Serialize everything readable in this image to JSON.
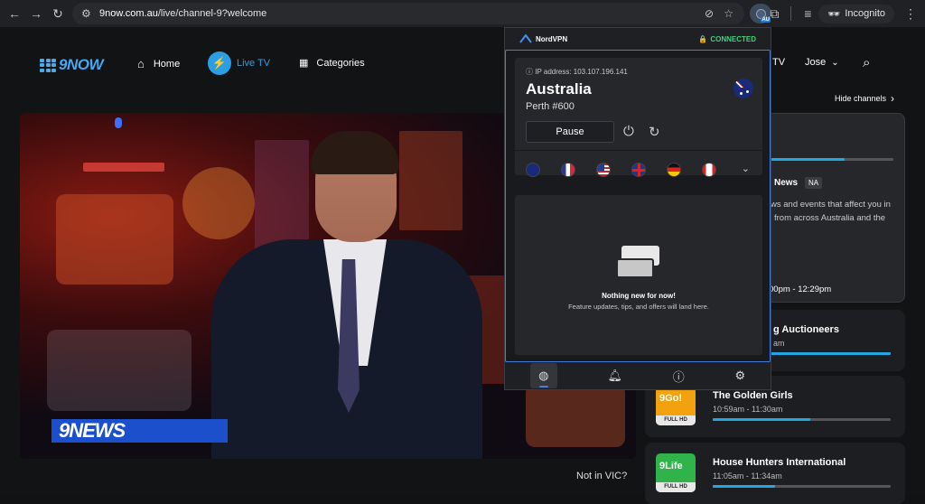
{
  "browser": {
    "url_host": "9now.com.au",
    "url_path": "/live/channel-9?welcome",
    "incognito_label": "Incognito",
    "extension_badge": "AU"
  },
  "site": {
    "logo_text": "9NOW",
    "nav": {
      "home": "Home",
      "live_tv": "Live TV",
      "categories": "Categories",
      "tv_partial": "TV",
      "user": "Jose"
    },
    "hide_channels": "Hide channels",
    "video_logo": "9NEWS",
    "not_in_vic": "Not in VIC?",
    "current_panel": {
      "title_partial": "News",
      "badge": "NA",
      "desc_line1": "ws and events that affect you in",
      "desc_line2": "from across Australia and the",
      "time_partial": "00pm - 12:29pm",
      "progress": 0.6
    },
    "schedule": [
      {
        "title": "g Auctioneers",
        "time": "am",
        "logo_text": "",
        "progress": 0.95
      },
      {
        "title": "The Golden Girls",
        "time": "10:59am - 11:30am",
        "logo_text": "9Go!",
        "badge": "FULL HD",
        "progress": 0.55
      },
      {
        "title": "House Hunters International",
        "time": "11:05am - 11:34am",
        "logo_text": "9Life",
        "badge": "FULL HD",
        "progress": 0.35
      }
    ]
  },
  "nordvpn": {
    "brand": "NordVPN",
    "status": "CONNECTED",
    "ip_label": "IP address: 103.107.196.141",
    "country": "Australia",
    "server": "Perth #600",
    "pause_label": "Pause",
    "quick_flags": [
      "Australia",
      "France",
      "United States",
      "United Kingdom",
      "Germany",
      "Canada"
    ],
    "empty_title": "Nothing new for now!",
    "empty_sub": "Feature updates, tips, and offers will land here.",
    "tabs": [
      "globe-icon",
      "bell-icon",
      "help-icon",
      "settings-icon"
    ]
  },
  "colors": {
    "accent": "#2a9fe4",
    "nord_connected": "#3cd479",
    "nord_border": "#4a7bd8"
  }
}
